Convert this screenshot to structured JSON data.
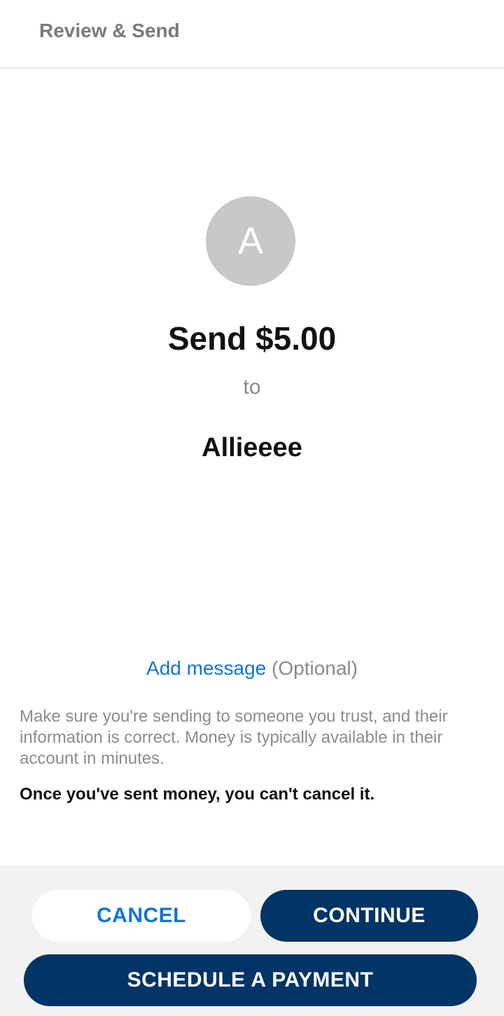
{
  "header": {
    "title": "Review & Send"
  },
  "recipient": {
    "initial": "A",
    "name": "Allieeee"
  },
  "payment": {
    "amount_text": "Send $5.00",
    "connector": "to"
  },
  "message": {
    "link_label": "Add message",
    "optional_label": "(Optional)"
  },
  "info": {
    "disclaimer": "Make sure you're sending to someone you trust, and their information is correct. Money is typically available in their account in minutes.",
    "warning": "Once you've sent money, you can't cancel it."
  },
  "actions": {
    "cancel_label": "CANCEL",
    "continue_label": "CONTINUE",
    "schedule_label": "SCHEDULE A PAYMENT"
  },
  "colors": {
    "primary_navy": "#033466",
    "link_blue": "#1474d4",
    "avatar_gray": "#c8c8c8"
  }
}
